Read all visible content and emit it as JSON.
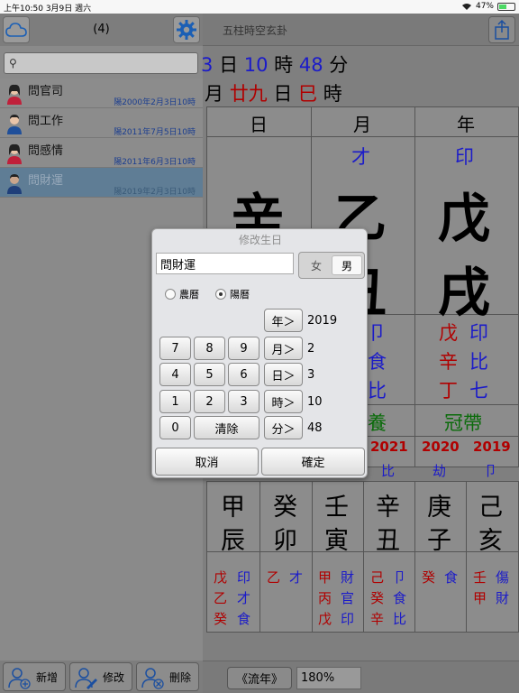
{
  "status": {
    "time": "上午10:50",
    "date": "3月9日 週六",
    "battery": "47%",
    "battery_level": 0.47
  },
  "left": {
    "count": "(4)",
    "search_placeholder": "",
    "items": [
      {
        "title": "問官司",
        "date": "陽2000年2月3日10時",
        "gender": "female"
      },
      {
        "title": "問工作",
        "date": "陽2011年7月5日10時",
        "gender": "male"
      },
      {
        "title": "問感情",
        "date": "陽2011年6月3日10時",
        "gender": "female"
      },
      {
        "title": "問財運",
        "date": "陽2019年2月3日10時",
        "gender": "male"
      }
    ],
    "footer": {
      "add": "新增",
      "edit": "修改",
      "delete": "刪除"
    }
  },
  "right": {
    "title": "五柱時空玄卦",
    "line1": {
      "a": "3",
      "b": "日",
      "c": "10",
      "d": "時",
      "e": "48",
      "f": "分"
    },
    "line2": {
      "a": "月",
      "b": "廿九",
      "c": "日",
      "d": "巳",
      "e": "時"
    },
    "headers": [
      "日",
      "月",
      "年"
    ],
    "gods": [
      "才",
      "印"
    ],
    "stems": [
      "辛",
      "乙",
      "戊"
    ],
    "branches": [
      "丑",
      "戌"
    ],
    "hidden_month": [
      "卩",
      "食",
      "比"
    ],
    "hidden_year": {
      "stems": [
        "戊",
        "辛",
        "丁"
      ],
      "gods": [
        "印",
        "比",
        "七"
      ]
    },
    "stage_month": "養",
    "stage_year": "冠帶",
    "years": [
      "2021",
      "2020",
      "2019"
    ],
    "year_gods": [
      "比",
      "劫",
      "卩"
    ],
    "cycle_stems": [
      "甲",
      "癸",
      "壬",
      "辛",
      "庚",
      "己"
    ],
    "cycle_branches": [
      "辰",
      "卯",
      "寅",
      "丑",
      "子",
      "亥"
    ],
    "cycle_hidden": [
      [
        "戊",
        "印",
        "乙",
        "才",
        "癸",
        "食"
      ],
      [
        "乙",
        "才"
      ],
      [
        "甲",
        "財",
        "丙",
        "官",
        "戊",
        "印"
      ],
      [
        "己",
        "卩",
        "癸",
        "食",
        "辛",
        "比"
      ],
      [
        "癸",
        "食"
      ],
      [
        "壬",
        "傷",
        "甲",
        "財"
      ]
    ],
    "footer": {
      "liunian": "《流年》",
      "zoom": "180%"
    }
  },
  "dialog": {
    "title": "修改生日",
    "name": "問財運",
    "female": "女",
    "male": "男",
    "lunar": "農曆",
    "solar": "陽曆",
    "keys": [
      "7",
      "8",
      "9",
      "4",
      "5",
      "6",
      "1",
      "2",
      "3",
      "0"
    ],
    "clear": "清除",
    "fields": [
      {
        "label": "年＞",
        "value": "2019"
      },
      {
        "label": "月＞",
        "value": "2"
      },
      {
        "label": "日＞",
        "value": "3"
      },
      {
        "label": "時＞",
        "value": "10"
      },
      {
        "label": "分＞",
        "value": "48"
      }
    ],
    "cancel": "取消",
    "ok": "確定"
  }
}
